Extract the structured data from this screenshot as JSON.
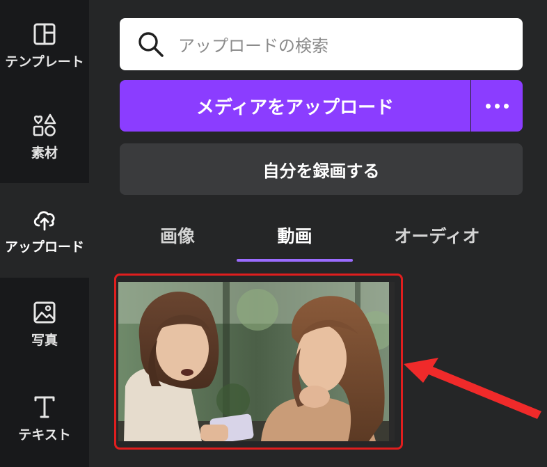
{
  "sidebar": {
    "items": [
      {
        "label": "テンプレート",
        "icon": "template-icon"
      },
      {
        "label": "素材",
        "icon": "elements-icon"
      },
      {
        "label": "アップロード",
        "icon": "cloud-upload-icon",
        "active": true
      },
      {
        "label": "写真",
        "icon": "photo-icon"
      },
      {
        "label": "テキスト",
        "icon": "text-icon"
      }
    ]
  },
  "search": {
    "placeholder": "アップロードの検索",
    "icon": "search-icon"
  },
  "buttons": {
    "upload_label": "メディアをアップロード",
    "more_icon": "more-dots-icon",
    "record_label": "自分を録画する"
  },
  "tabs": [
    {
      "label": "画像"
    },
    {
      "label": "動画",
      "active": true
    },
    {
      "label": "オーディオ"
    }
  ],
  "colors": {
    "accent": "#8b3dff",
    "highlight": "#e01e1e",
    "panel_bg": "#252627",
    "rail_bg": "#18191b"
  }
}
